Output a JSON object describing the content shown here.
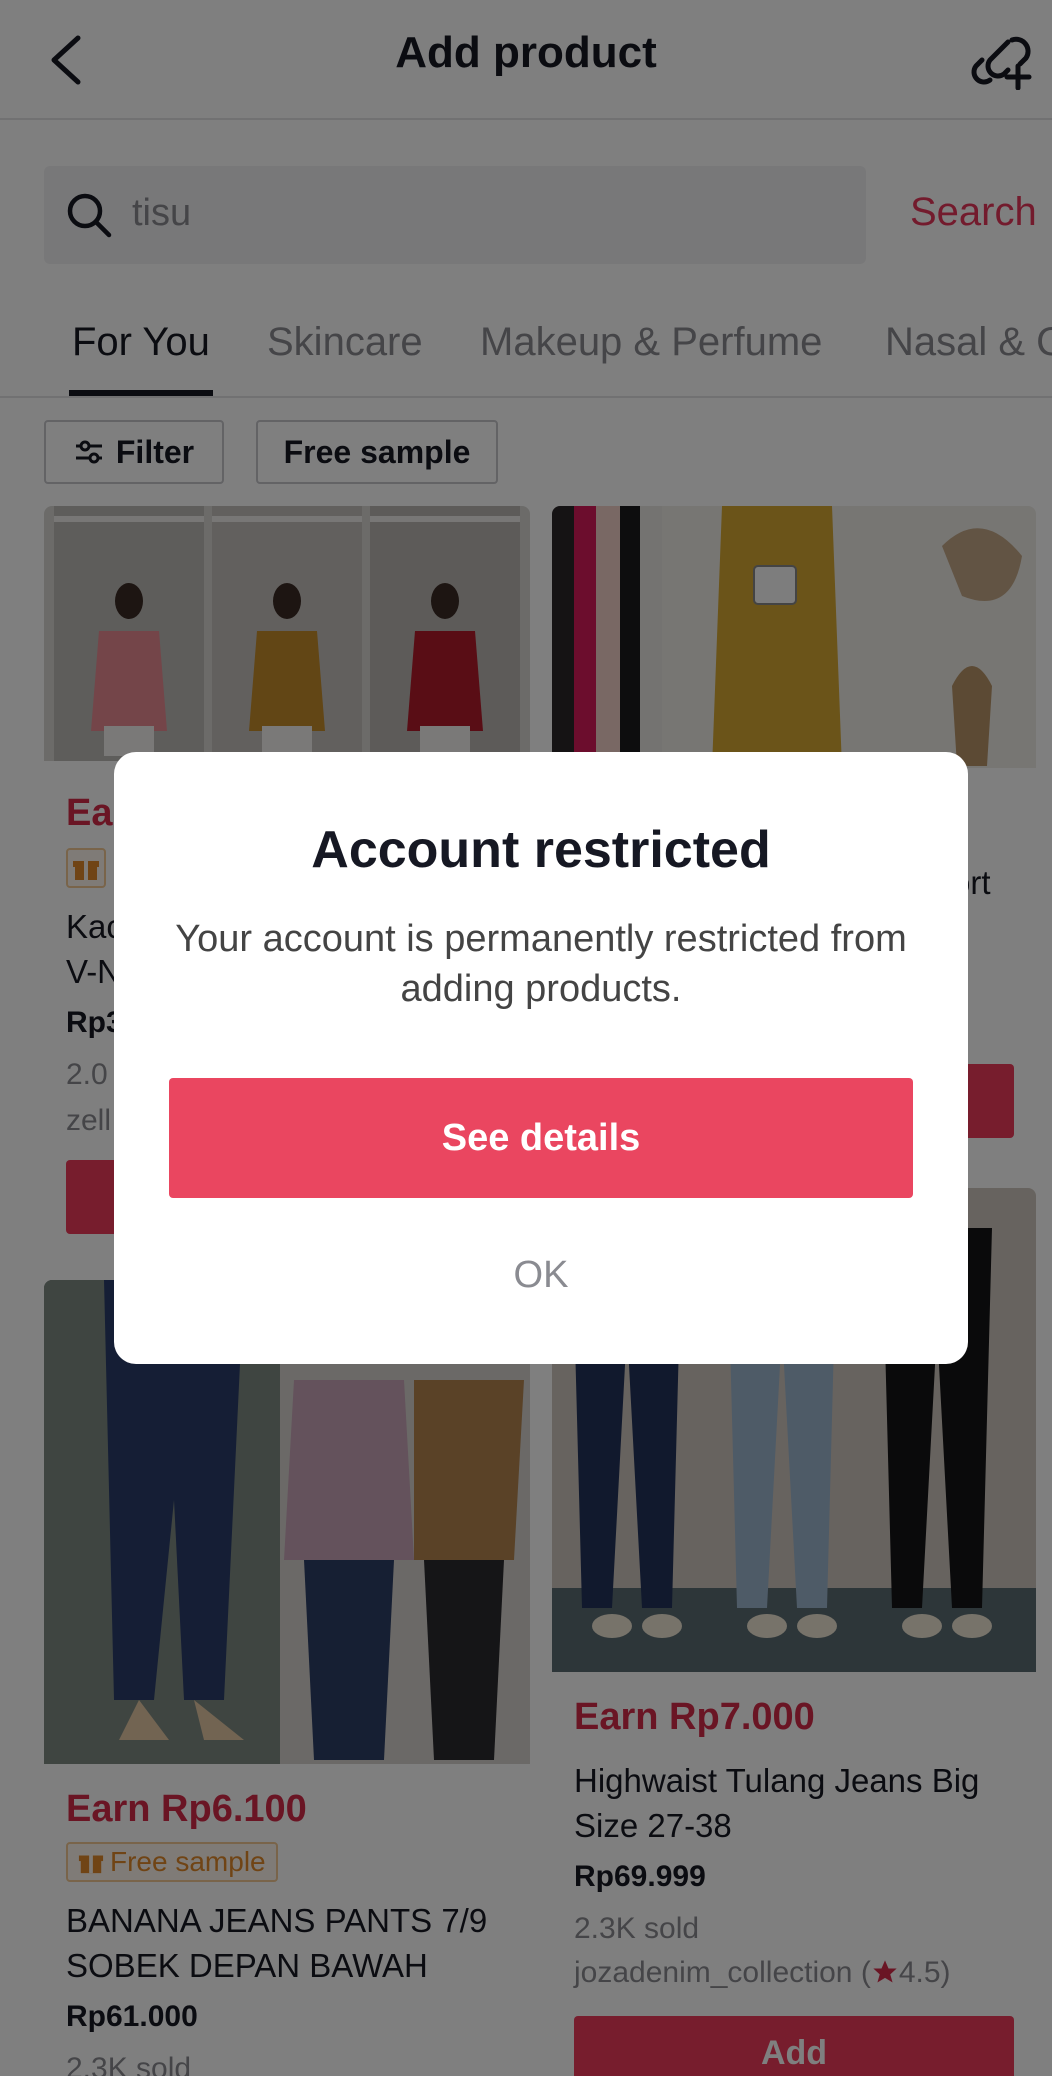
{
  "header": {
    "title": "Add product",
    "back_icon": "chevron-left-icon",
    "action_icon": "add-link-icon"
  },
  "search": {
    "query": "tisu",
    "button_label": "Search"
  },
  "tabs": [
    {
      "label": "For You",
      "active": true
    },
    {
      "label": "Skincare",
      "active": false
    },
    {
      "label": "Makeup & Perfume",
      "active": false
    },
    {
      "label": "Nasal & C",
      "active": false
    }
  ],
  "chips": {
    "filter_label": "Filter",
    "free_sample_label": "Free sample"
  },
  "products": [
    {
      "earn": "Ea",
      "title": "Kac\nV-N",
      "price": "Rp3",
      "sold": "2.0",
      "shop": "zell",
      "add_label": ""
    },
    {
      "title_fragment": "ort",
      "add_label": ""
    },
    {
      "earn": "Earn Rp6.100",
      "badge": "Free sample",
      "title": "BANANA JEANS PANTS 7/9 SOBEK DEPAN BAWAH",
      "price": "Rp61.000",
      "sold": "2.3K sold"
    },
    {
      "earn": "Earn Rp7.000",
      "title": "Highwaist Tulang Jeans Big Size 27-38",
      "price": "Rp69.999",
      "sold": "2.3K sold",
      "shop": "jozadenim_collection (",
      "rating": "4.5",
      "shop_close": ")",
      "add_label": "Add"
    }
  ],
  "colors": {
    "accent": "#ea4660",
    "earn": "#d42a49",
    "overlay": "rgba(0,0,0,0.5)"
  },
  "modal": {
    "title": "Account restricted",
    "message": "Your account is permanently restricted from adding products.",
    "primary_label": "See details",
    "secondary_label": "OK"
  }
}
